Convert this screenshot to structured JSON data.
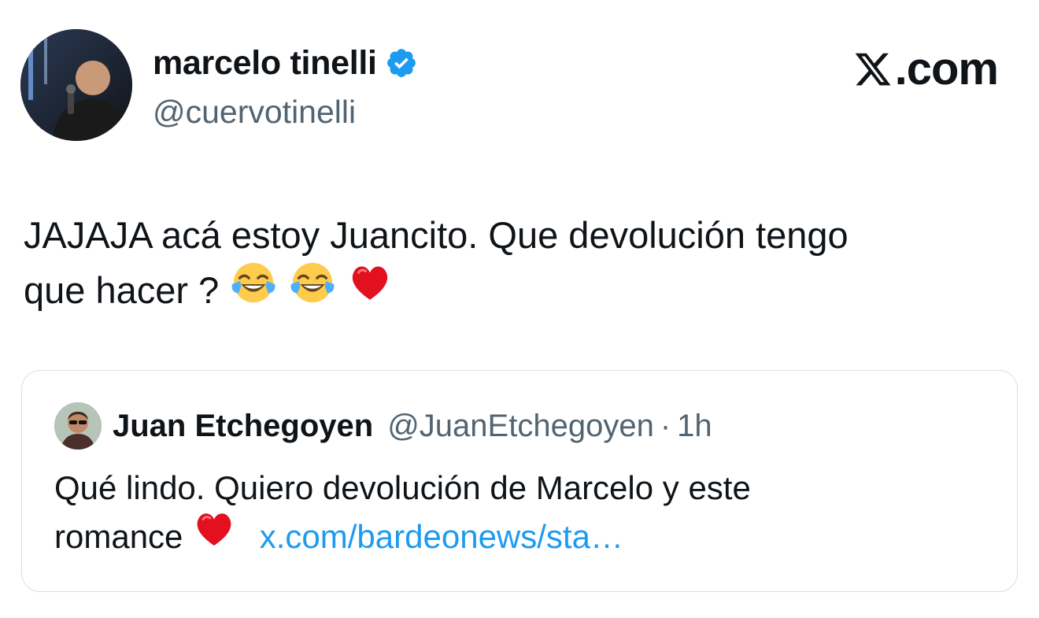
{
  "author": {
    "name": "marcelo tinelli",
    "handle": "@cuervotinelli",
    "verified": true,
    "verified_color": "#1d9bf0"
  },
  "brand": {
    "logo_text": ".com",
    "logo_icon": "x-logo-icon"
  },
  "tweet": {
    "line1": "JAJAJA acá estoy Juancito. Que devolución tengo",
    "line2": "que hacer ?",
    "emojis": [
      "face-with-tears-of-joy",
      "face-with-tears-of-joy",
      "red-heart"
    ]
  },
  "quoted_tweet": {
    "name": "Juan Etchegoyen",
    "handle": "@JuanEtchegoyen",
    "separator": "·",
    "time": "1h",
    "line1": "Qué lindo. Quiero devolución de Marcelo y este",
    "line2": "romance",
    "emoji": "red-heart",
    "link": "x.com/bardeonews/sta…",
    "link_color": "#1d9bf0"
  }
}
